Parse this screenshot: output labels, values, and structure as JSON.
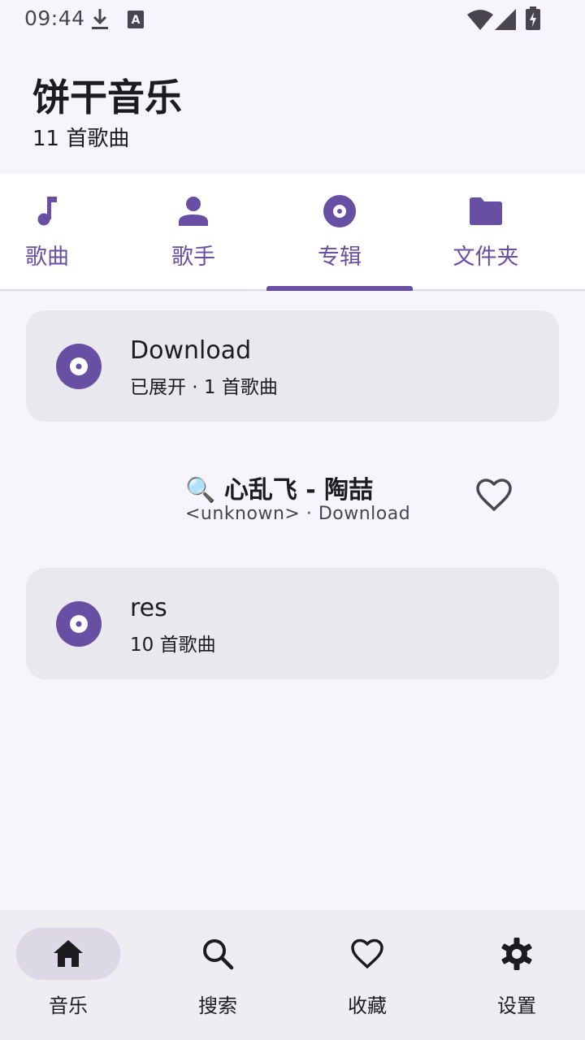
{
  "status_bar": {
    "time": "09:44",
    "icons": [
      "download-icon",
      "keyboard-a-icon",
      "wifi-icon",
      "cellular-signal-icon",
      "battery-charging-icon"
    ]
  },
  "header": {
    "title": "饼干音乐",
    "song_count": "11 首歌曲"
  },
  "tabs": [
    {
      "label": "歌曲",
      "icon": "music-note-icon"
    },
    {
      "label": "歌手",
      "icon": "person-icon"
    },
    {
      "label": "专辑",
      "icon": "album-icon",
      "selected": true
    },
    {
      "label": "文件夹",
      "icon": "folder-icon"
    }
  ],
  "albums": [
    {
      "title": "Download",
      "subtitle": "已展开 · 1 首歌曲",
      "icon": "album-icon"
    },
    {
      "title": "res",
      "subtitle": "10 首歌曲",
      "icon": "album-icon"
    }
  ],
  "expanded_song": {
    "emoji": "🔍",
    "title": "心乱飞 - 陶喆",
    "subtitle": "<unknown> · Download",
    "favorite_icon": "heart-outline-icon"
  },
  "bottom_nav": [
    {
      "label": "音乐",
      "icon": "home-icon",
      "selected": true
    },
    {
      "label": "搜索",
      "icon": "search-icon"
    },
    {
      "label": "收藏",
      "icon": "heart-outline-icon"
    },
    {
      "label": "设置",
      "icon": "gear-icon"
    }
  ],
  "colors": {
    "accent": "#6750a4",
    "background": "#f5f5fb",
    "card": "#e8e8ee",
    "nav_background": "#efedf4",
    "nav_pill": "#ddd8e6"
  }
}
